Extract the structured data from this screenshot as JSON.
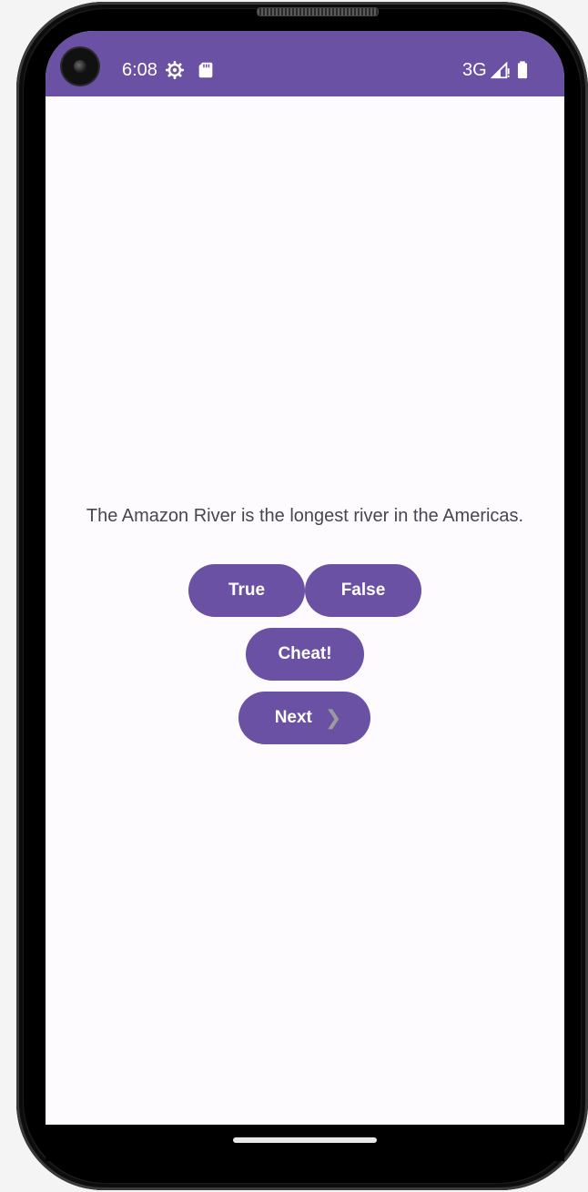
{
  "status_bar": {
    "time": "6:08",
    "network": "3G",
    "settings_icon": "gear-icon",
    "sd_icon": "sd-card-icon",
    "signal_icon": "signal-icon",
    "battery_icon": "battery-icon",
    "background_color": "#6a51a4"
  },
  "quiz": {
    "question": "The Amazon River is the longest river in the Americas."
  },
  "buttons": {
    "true_label": "True",
    "false_label": "False",
    "cheat_label": "Cheat!",
    "next_label": "Next",
    "next_icon": "chevron-right-icon"
  },
  "colors": {
    "accent": "#6a51a4",
    "screen_background": "#fefbff",
    "question_text": "#49454f"
  }
}
